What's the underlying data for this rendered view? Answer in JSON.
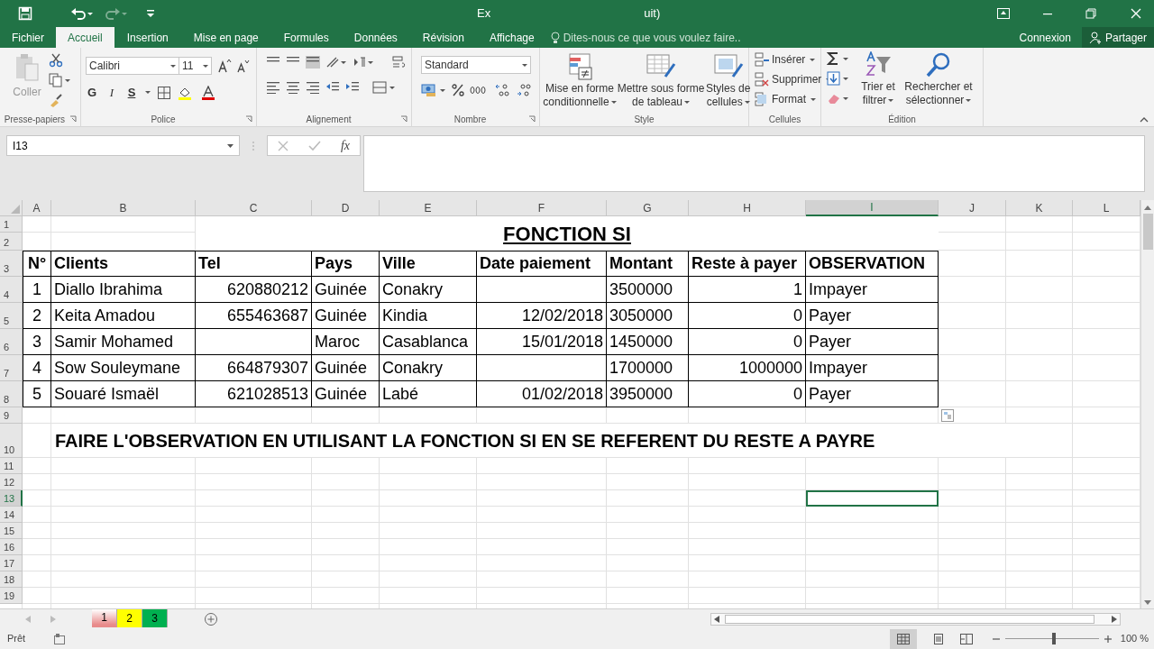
{
  "window": {
    "title_parts": [
      "Ex",
      "uit)"
    ]
  },
  "tabs": [
    {
      "label": "Fichier",
      "selected": false
    },
    {
      "label": "Accueil",
      "selected": true
    },
    {
      "label": "Insertion",
      "selected": false
    },
    {
      "label": "Mise en page",
      "selected": false
    },
    {
      "label": "Formules",
      "selected": false
    },
    {
      "label": "Données",
      "selected": false
    },
    {
      "label": "Révision",
      "selected": false
    },
    {
      "label": "Affichage",
      "selected": false
    }
  ],
  "tell_me": "Dites-nous ce que vous voulez faire..",
  "account": {
    "sign_in": "Connexion",
    "share": "Partager"
  },
  "ribbon": {
    "paste": "Coller",
    "font": "Calibri",
    "size": "11",
    "bold": "G",
    "italic": "I",
    "underline": "S",
    "number_format": "Standard",
    "conditional": [
      "Mise en forme",
      "conditionnelle"
    ],
    "table_format": [
      "Mettre sous forme",
      "de tableau"
    ],
    "cell_styles": [
      "Styles de",
      "cellules"
    ],
    "cells": [
      "Insérer",
      "Supprimer",
      "Format"
    ],
    "sort": [
      "Trier et",
      "filtrer"
    ],
    "find": [
      "Rechercher et",
      "sélectionner"
    ],
    "groups": [
      "Presse-papiers",
      "Police",
      "Alignement",
      "Nombre",
      "Style",
      "Cellules",
      "Édition"
    ]
  },
  "formula_bar": {
    "name_box": "I13",
    "function_label": "fx"
  },
  "sheet": {
    "columns": [
      {
        "label": "A",
        "selected": false
      },
      {
        "label": "B",
        "selected": false
      },
      {
        "label": "C",
        "selected": false
      },
      {
        "label": "D",
        "selected": false
      },
      {
        "label": "E",
        "selected": false
      },
      {
        "label": "F",
        "selected": false
      },
      {
        "label": "G",
        "selected": false
      },
      {
        "label": "H",
        "selected": false
      },
      {
        "label": "I",
        "selected": true
      },
      {
        "label": "J",
        "selected": false
      },
      {
        "label": "K",
        "selected": false
      },
      {
        "label": "L",
        "selected": false
      }
    ],
    "rows": [
      {
        "label": "1",
        "selected": false
      },
      {
        "label": "2",
        "selected": false
      },
      {
        "label": "3",
        "selected": false
      },
      {
        "label": "4",
        "selected": false
      },
      {
        "label": "5",
        "selected": false
      },
      {
        "label": "6",
        "selected": false
      },
      {
        "label": "7",
        "selected": false
      },
      {
        "label": "8",
        "selected": false
      },
      {
        "label": "9",
        "selected": false
      },
      {
        "label": "10",
        "selected": false
      },
      {
        "label": "11",
        "selected": false
      },
      {
        "label": "12",
        "selected": false
      },
      {
        "label": "13",
        "selected": true
      },
      {
        "label": "14",
        "selected": false
      },
      {
        "label": "15",
        "selected": false
      },
      {
        "label": "16",
        "selected": false
      },
      {
        "label": "17",
        "selected": false
      },
      {
        "label": "18",
        "selected": false
      },
      {
        "label": "19",
        "selected": false
      }
    ],
    "title": "FONCTION SI",
    "table": {
      "headers": [
        "N°",
        "Clients",
        "Tel",
        "Pays",
        "Ville",
        "Date paiement",
        "Montant",
        "Reste à payer",
        "OBSERVATION"
      ],
      "rows": [
        {
          "n": "1",
          "client": "Diallo Ibrahima",
          "tel": "620880212",
          "pays": "Guinée",
          "ville": "Conakry",
          "montant": "3500000",
          "reste": "1",
          "observation": "Impayer"
        },
        {
          "n": "2",
          "client": "Keita Amadou",
          "tel": "655463687",
          "pays": "Guinée",
          "ville": "Kindia",
          "date": "12/02/2018",
          "montant": "3050000",
          "reste": "0",
          "observation": "Payer"
        },
        {
          "n": "3",
          "client": "Samir Mohamed",
          "pays": "Maroc",
          "ville": "Casablanca",
          "date": "15/01/2018",
          "montant": "1450000",
          "reste": "0",
          "observation": "Payer"
        },
        {
          "n": "4",
          "client": "Sow Souleymane",
          "tel": "664879307",
          "pays": "Guinée",
          "ville": "Conakry",
          "montant": "1700000",
          "reste": "1000000",
          "observation": "Impayer"
        },
        {
          "n": "5",
          "client": "Souaré Ismaël",
          "tel": "621028513",
          "pays": "Guinée",
          "ville": "Labé",
          "date": "01/02/2018",
          "montant": "3950000",
          "reste": "0",
          "observation": "Payer"
        }
      ]
    },
    "instruction": "FAIRE L'OBSERVATION EN UTILISANT LA FONCTION SI EN SE REFERENT DU RESTE A PAYRE"
  },
  "sheet_tabs": [
    {
      "label": "1",
      "color": "#e88a8a",
      "selected": true
    },
    {
      "label": "2",
      "color": "#ffff00",
      "selected": false
    },
    {
      "label": "3",
      "color": "#00b050",
      "selected": false
    }
  ],
  "status_bar": {
    "status": "Prêt",
    "zoom": {
      "label": "100 %",
      "level": 0.5
    }
  }
}
